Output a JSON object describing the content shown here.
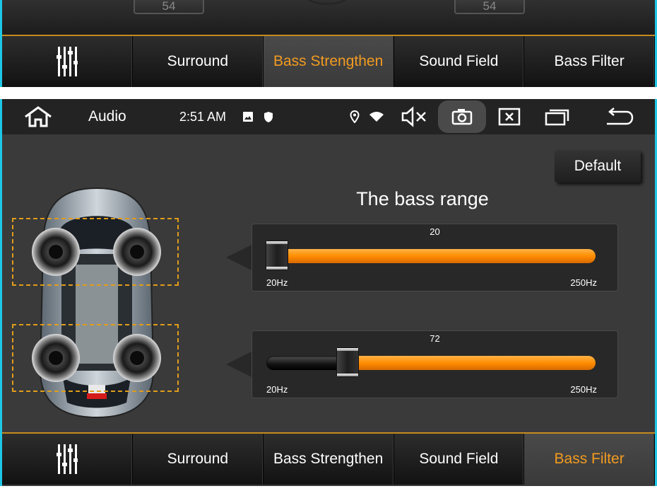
{
  "top_panel": {
    "knob_left_value": "54",
    "knob_right_value": "54",
    "tabs": [
      {
        "label": "Surround",
        "active": false
      },
      {
        "label": "Bass Strengthen",
        "active": true
      },
      {
        "label": "Sound Field",
        "active": false
      },
      {
        "label": "Bass Filter",
        "active": false
      }
    ]
  },
  "status_bar": {
    "app_title": "Audio",
    "time": "2:51 AM",
    "icons": [
      "home-icon",
      "image-icon",
      "shield-icon",
      "location-icon",
      "wifi-icon",
      "mute-icon",
      "screenshot-icon",
      "close-window-icon",
      "recent-apps-icon",
      "back-icon"
    ]
  },
  "bass_filter": {
    "default_label": "Default",
    "title": "The bass range",
    "sliders": [
      {
        "value": 20,
        "fraction": 0.0,
        "min_label": "20Hz",
        "max_label": "250Hz"
      },
      {
        "value": 72,
        "fraction": 0.23,
        "min_label": "20Hz",
        "max_label": "250Hz"
      }
    ]
  },
  "bottom_tabs": [
    {
      "label": "Surround",
      "active": false
    },
    {
      "label": "Bass Strengthen",
      "active": false
    },
    {
      "label": "Sound Field",
      "active": false
    },
    {
      "label": "Bass Filter",
      "active": true
    }
  ],
  "colors": {
    "accent": "#f39b1f",
    "frame": "#1fc7e6",
    "zone_border": "#e09d1a"
  }
}
